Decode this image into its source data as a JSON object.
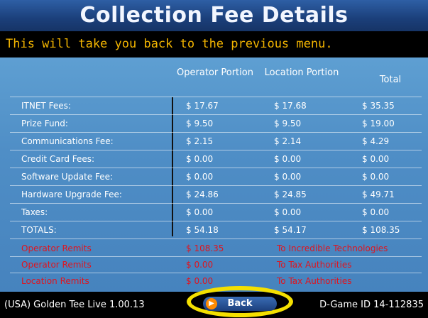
{
  "title": "Collection Fee Details",
  "subtitle": "This will take you back to the previous menu.",
  "columns": {
    "operator": "Operator Portion",
    "location": "Location Portion",
    "total": "Total"
  },
  "rows": [
    {
      "label": "ITNET Fees:",
      "operator": "$ 17.67",
      "location": "$ 17.68",
      "total": "$ 35.35"
    },
    {
      "label": "Prize Fund:",
      "operator": "$ 9.50",
      "location": "$ 9.50",
      "total": "$ 19.00"
    },
    {
      "label": "Communications Fee:",
      "operator": "$ 2.15",
      "location": "$ 2.14",
      "total": "$ 4.29"
    },
    {
      "label": "Credit Card Fees:",
      "operator": "$ 0.00",
      "location": "$ 0.00",
      "total": "$ 0.00"
    },
    {
      "label": "Software Update Fee:",
      "operator": "$ 0.00",
      "location": "$ 0.00",
      "total": "$ 0.00"
    },
    {
      "label": "Hardware Upgrade Fee:",
      "operator": "$ 24.86",
      "location": "$ 24.85",
      "total": "$ 49.71"
    },
    {
      "label": "Taxes:",
      "operator": "$ 0.00",
      "location": "$ 0.00",
      "total": "$ 0.00"
    },
    {
      "label": "TOTALS:",
      "operator": "$ 54.18",
      "location": "$ 54.17",
      "total": "$ 108.35"
    }
  ],
  "remits": [
    {
      "who": "Operator Remits",
      "amount": "$ 108.35",
      "to": "To Incredible Technologies"
    },
    {
      "who": "Operator Remits",
      "amount": "$ 0.00",
      "to": "To Tax Authorities"
    },
    {
      "who": "Location Remits",
      "amount": "$ 0.00",
      "to": "To Tax Authorities"
    }
  ],
  "footer": {
    "version": "(USA) Golden Tee Live 1.00.13",
    "back_label": "Back",
    "game_id": "D-Game ID 14-112835"
  },
  "colors": {
    "title_bg": "#1b3f7a",
    "panel_bg": "#4f8ec6",
    "subtitle_text": "#f2b400",
    "remit_text": "#e0141e",
    "highlight_ring": "#f4e000"
  }
}
